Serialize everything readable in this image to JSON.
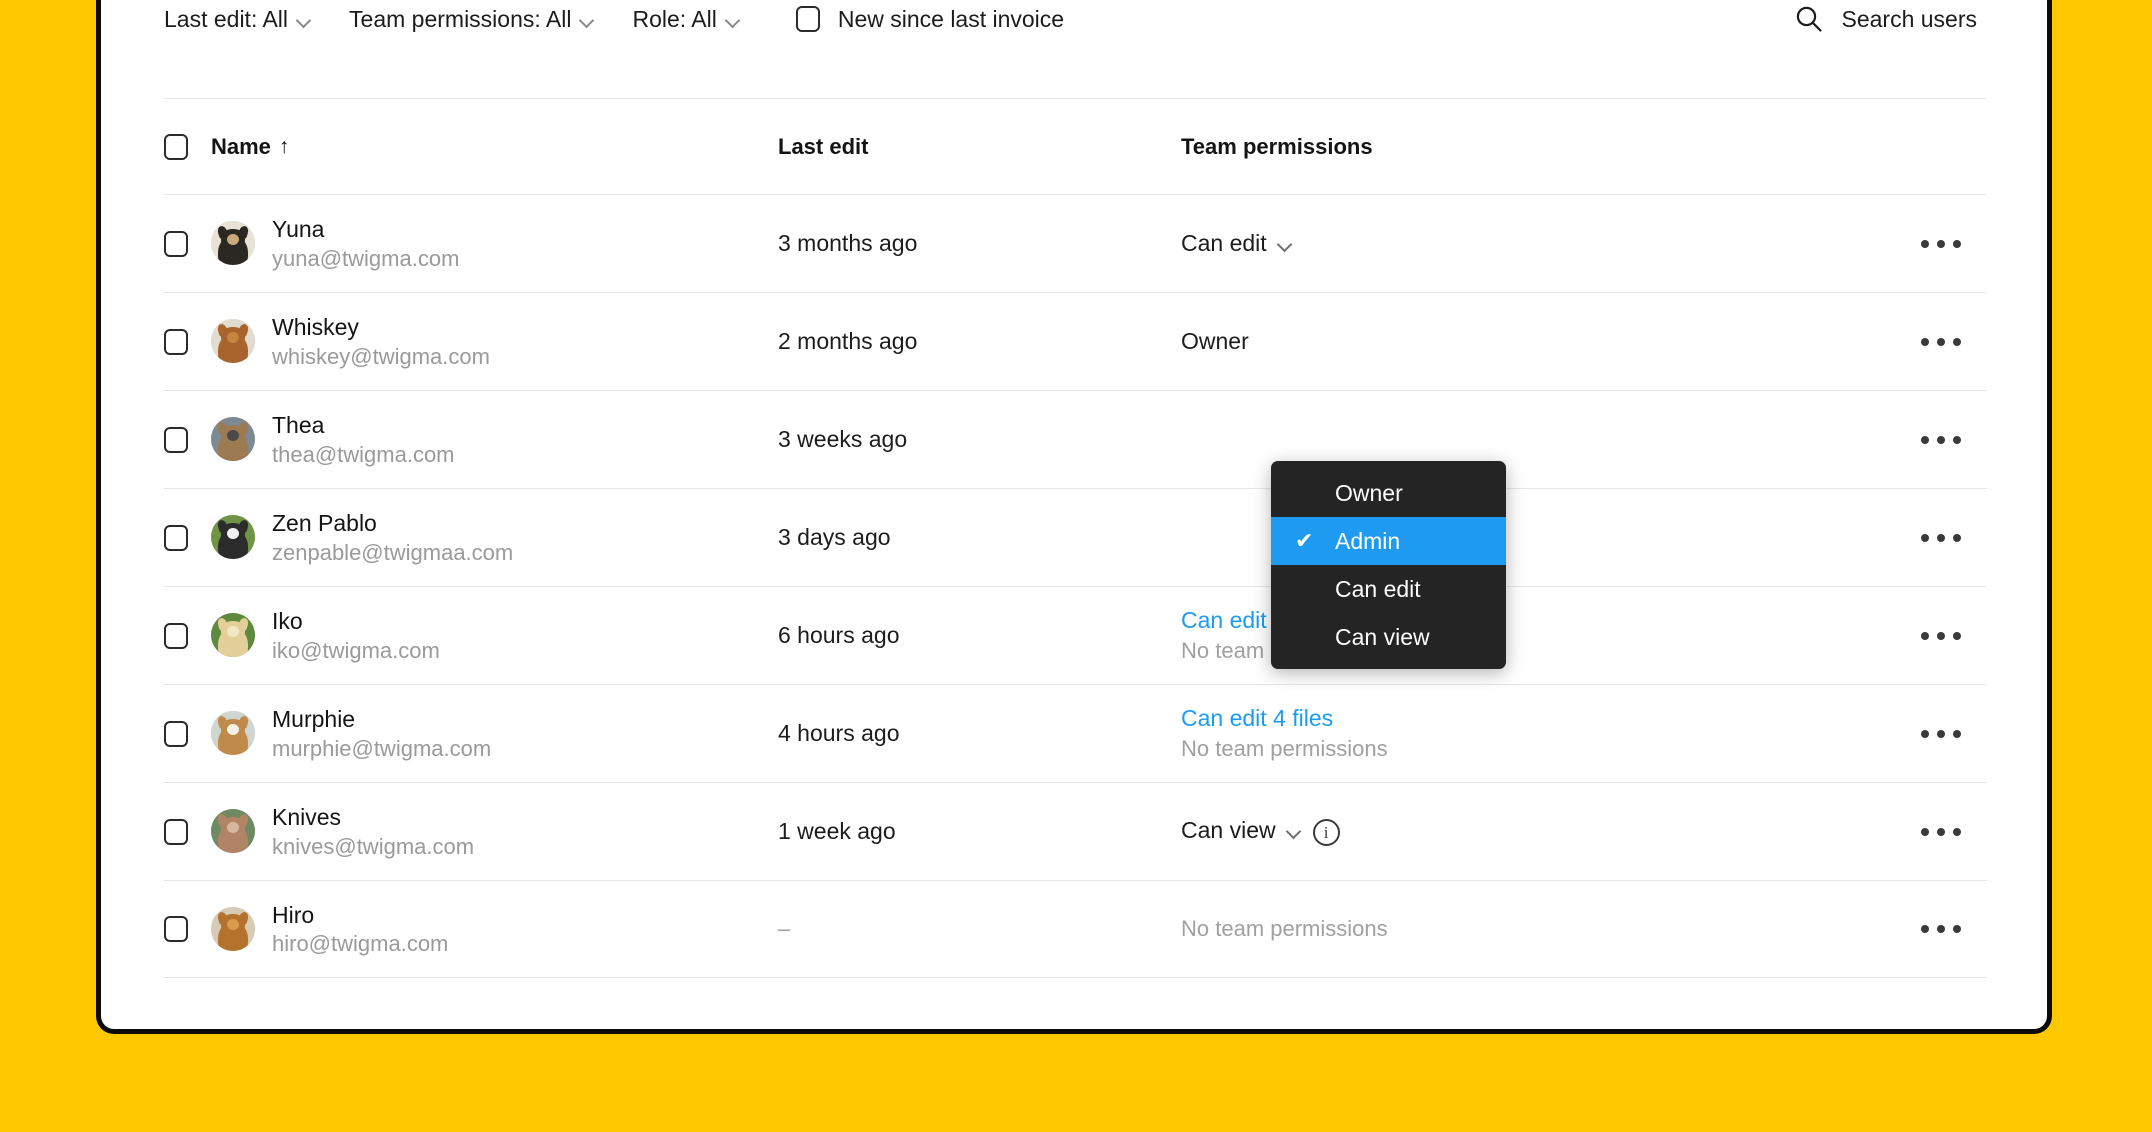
{
  "theme": {
    "page_background": "#FFC800",
    "card_background": "#FFFFFF",
    "accent_blue": "#1E9BF0",
    "menu_background": "#242424",
    "muted_text": "#9A9A9A"
  },
  "toolbar": {
    "filters": [
      {
        "label": "Last edit: All",
        "icon": "chevron-down-icon"
      },
      {
        "label": "Team permissions: All",
        "icon": "chevron-down-icon"
      },
      {
        "label": "Role: All",
        "icon": "chevron-down-icon"
      }
    ],
    "new_since_invoice": {
      "label": "New since last invoice",
      "checked": false
    },
    "search": {
      "label": "Search users",
      "icon": "search-icon"
    }
  },
  "table": {
    "columns": [
      {
        "key": "name",
        "label": "Name",
        "sort_indicator": "↑"
      },
      {
        "key": "last_edit",
        "label": "Last edit"
      },
      {
        "key": "team_permissions",
        "label": "Team permissions"
      }
    ],
    "select_all_checked": false,
    "rows": [
      {
        "name": "Yuna",
        "email": "yuna@twigma.com",
        "last_edit": "3 months ago",
        "permission_label": "Can edit",
        "permission_type": "select",
        "permission_sub": "",
        "has_info": false,
        "avatar": {
          "name": "avatar-yuna",
          "fur": "#2b2723",
          "fur2": "#c9a979",
          "bg": "#e8e2d6"
        }
      },
      {
        "name": "Whiskey",
        "email": "whiskey@twigma.com",
        "last_edit": "2 months ago",
        "permission_label": "Owner",
        "permission_type": "text",
        "permission_sub": "",
        "has_info": false,
        "avatar": {
          "name": "avatar-whiskey",
          "fur": "#a8642c",
          "fur2": "#c8853f",
          "bg": "#e0dccf"
        }
      },
      {
        "name": "Thea",
        "email": "thea@twigma.com",
        "last_edit": "3 weeks ago",
        "permission_label": "",
        "permission_type": "none",
        "permission_sub": "",
        "has_info": false,
        "avatar": {
          "name": "avatar-thea",
          "fur": "#9c7a52",
          "fur2": "#4a4a4a",
          "bg": "#7e8a92"
        }
      },
      {
        "name": "Zen Pablo",
        "email": "zenpable@twigmaa.com",
        "last_edit": "3 days ago",
        "permission_label": "",
        "permission_type": "none",
        "permission_sub": "",
        "has_info": false,
        "avatar": {
          "name": "avatar-zen-pablo",
          "fur": "#2c2c2c",
          "fur2": "#f2f2f2",
          "bg": "#6f9445"
        }
      },
      {
        "name": "Iko",
        "email": "iko@twigma.com",
        "last_edit": "6 hours ago",
        "permission_label": "Can edit files in 2 projects",
        "permission_type": "link",
        "permission_sub": "No team permissions",
        "has_info": false,
        "avatar": {
          "name": "avatar-iko",
          "fur": "#e3cf9a",
          "fur2": "#f3e7c2",
          "bg": "#5d8a3d"
        }
      },
      {
        "name": "Murphie",
        "email": "murphie@twigma.com",
        "last_edit": "4 hours ago",
        "permission_label": "Can edit 4 files",
        "permission_type": "link",
        "permission_sub": "No team permissions",
        "has_info": false,
        "avatar": {
          "name": "avatar-murphie",
          "fur": "#c08a4a",
          "fur2": "#f6f1e6",
          "bg": "#cfd5d1"
        }
      },
      {
        "name": "Knives",
        "email": "knives@twigma.com",
        "last_edit": "1 week ago",
        "permission_label": "Can view",
        "permission_type": "select",
        "permission_sub": "",
        "has_info": true,
        "avatar": {
          "name": "avatar-knives",
          "fur": "#b08464",
          "fur2": "#d7b79c",
          "bg": "#6d8a63"
        }
      },
      {
        "name": "Hiro",
        "email": "hiro@twigma.com",
        "last_edit": "–",
        "permission_label": "No team permissions",
        "permission_type": "muted",
        "permission_sub": "",
        "has_info": false,
        "avatar": {
          "name": "avatar-hiro",
          "fur": "#b5722c",
          "fur2": "#d99b4e",
          "bg": "#d8cbb5"
        }
      }
    ],
    "row_action_icon": "kebab-menu-icon"
  },
  "role_menu": {
    "anchor_row": "Whiskey",
    "items": [
      {
        "label": "Owner",
        "selected": false
      },
      {
        "label": "Admin",
        "selected": true
      },
      {
        "label": "Can edit",
        "selected": false
      },
      {
        "label": "Can view",
        "selected": false
      }
    ],
    "check_glyph": "✔"
  }
}
